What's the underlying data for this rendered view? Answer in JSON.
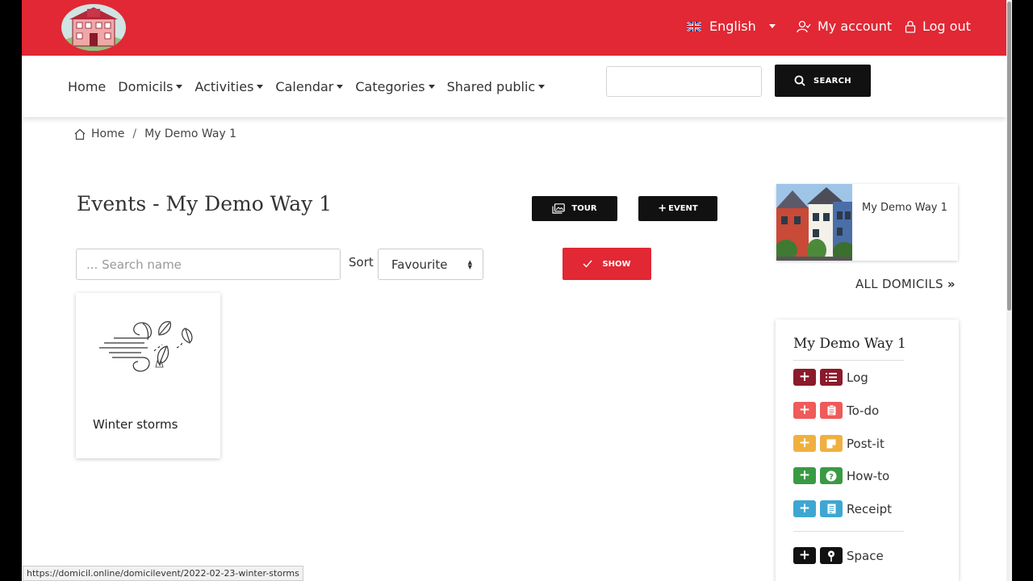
{
  "header": {
    "language": "English",
    "account": "My account",
    "logout": "Log out"
  },
  "nav": {
    "items": [
      "Home",
      "Domicils",
      "Activities",
      "Calendar",
      "Categories",
      "Shared public"
    ],
    "search_label": "SEARCH",
    "search_value": ""
  },
  "breadcrumb": {
    "home": "Home",
    "separator": "/",
    "current": "My Demo Way 1"
  },
  "main": {
    "title": "Events - My Demo Way 1",
    "tour_label": "TOUR",
    "event_label": "EVENT",
    "search_placeholder": "... Search name",
    "sort_label": "Sort",
    "sort_selected": "Favourite",
    "show_label": "SHOW",
    "cards": [
      {
        "label": "Winter storms",
        "icon": "wind-leaves-icon"
      }
    ]
  },
  "sidebar": {
    "domicile_name": "My Demo Way 1",
    "all_domicils": "ALL DOMICILS",
    "panel_title": "My Demo Way 1",
    "rows": [
      {
        "label": "Log",
        "color": "#8b1a2b",
        "icon": "list-icon"
      },
      {
        "label": "To-do",
        "color": "#ef5a5a",
        "icon": "clipboard-icon"
      },
      {
        "label": "Post-it",
        "color": "#f0b040",
        "icon": "note-icon"
      },
      {
        "label": "How-to",
        "color": "#3a9a43",
        "icon": "question-icon"
      },
      {
        "label": "Receipt",
        "color": "#3ea6d3",
        "icon": "receipt-icon"
      },
      {
        "label": "Space",
        "color": "#111111",
        "icon": "pin-icon"
      }
    ]
  },
  "status_url": "https://domicil.online/domicilevent/2022-02-23-winter-storms",
  "colors": {
    "brand": "#e12834",
    "dark_button": "#111111"
  }
}
